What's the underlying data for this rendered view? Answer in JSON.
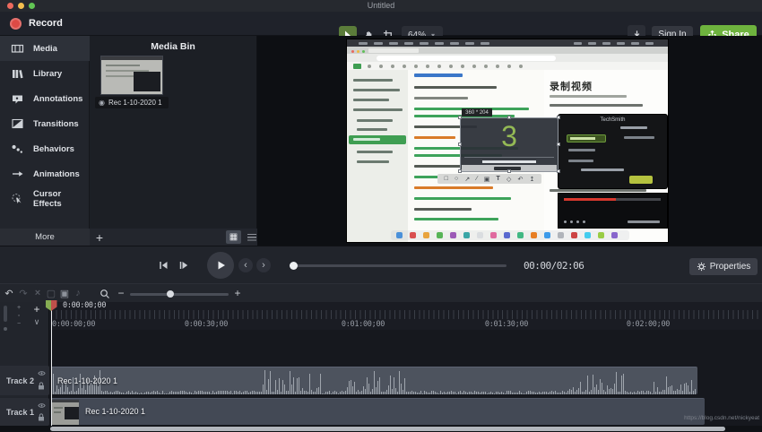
{
  "window": {
    "title": "Untitled"
  },
  "header": {
    "record_label": "Record",
    "zoom_level": "64%",
    "sign_in_label": "Sign In",
    "share_label": "Share"
  },
  "sidebar": {
    "items": [
      {
        "label": "Media",
        "icon": "filmstrip-icon",
        "selected": true
      },
      {
        "label": "Library",
        "icon": "books-icon",
        "selected": false
      },
      {
        "label": "Annotations",
        "icon": "callout-icon",
        "selected": false
      },
      {
        "label": "Transitions",
        "icon": "transition-square-icon",
        "selected": false
      },
      {
        "label": "Behaviors",
        "icon": "motion-dots-icon",
        "selected": false
      },
      {
        "label": "Animations",
        "icon": "arrow-icon",
        "selected": false
      },
      {
        "label": "Cursor Effects",
        "icon": "cursor-ripple-icon",
        "selected": false
      }
    ],
    "more_label": "More"
  },
  "media_bin": {
    "title": "Media Bin",
    "clip_name": "Rec 1-10-2020 1"
  },
  "preview": {
    "doc_title": "录制视频",
    "countdown": "3",
    "size_tooltip": "360 * 204",
    "recorder_title": "TechSmith",
    "anno_tools": [
      "□",
      "○",
      "↗",
      "∕",
      "▣",
      "T",
      "◇",
      "↶",
      "↥"
    ]
  },
  "transport": {
    "time_display": "00:00/02:06",
    "properties_label": "Properties"
  },
  "edit_tools": {
    "glyphs": [
      "↶",
      "↷",
      "×",
      "▢",
      "▣",
      "♪"
    ]
  },
  "timeline": {
    "current_time": "0:00:00;00",
    "ruler_labels": [
      "0:00:00;00",
      "0:00:30;00",
      "0:01:00;00",
      "0:01:30;00",
      "0:02:00;00"
    ],
    "tracks": [
      {
        "name": "Track 2",
        "clip_name": "Rec 1-10-2020 1"
      },
      {
        "name": "Track 1",
        "clip_name": "Rec 1-10-2020 1"
      }
    ]
  },
  "watermark": "https://blog.csdn.net/nickyeat",
  "colors": {
    "accent_green": "#6eb33e",
    "record_red": "#dd4a45",
    "countdown_green": "#94ba55",
    "tool_selected_green": "#5b7c3a"
  }
}
